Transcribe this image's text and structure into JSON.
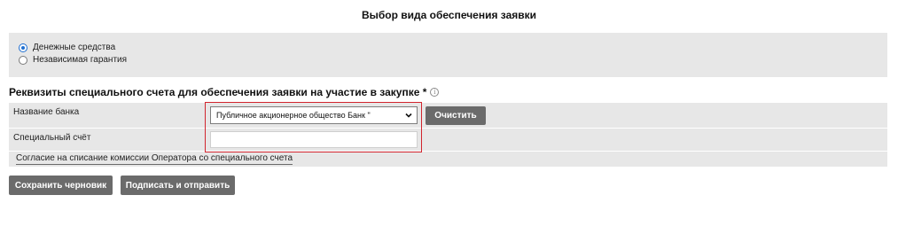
{
  "header": {
    "title": "Выбор вида обеспечения заявки"
  },
  "guarantee_type": {
    "options": [
      {
        "label": "Денежные средства",
        "checked": true
      },
      {
        "label": "Независимая гарантия",
        "checked": false
      }
    ]
  },
  "special_account": {
    "section_title": "Реквизиты специального счета для обеспечения заявки на участие в закупке *",
    "bank_name_label": "Название банка",
    "bank_name_value": "Публичное акционерное общество Банк \"",
    "clear_button": "Очистить",
    "account_label": "Специальный счёт",
    "account_value": "",
    "consent_link": "Согласие на списание комиссии Оператора со специального счета"
  },
  "actions": {
    "save_draft": "Сохранить черновик",
    "sign_and_send": "Подписать и отправить"
  },
  "icons": {
    "info": "info-icon",
    "select_arrow": "chevron-down-icon"
  },
  "colors": {
    "button_bg": "#6b6b6b",
    "panel_bg": "#e7e7e7",
    "highlight_border": "#d2252e",
    "radio_accent": "#1f6fd1"
  }
}
